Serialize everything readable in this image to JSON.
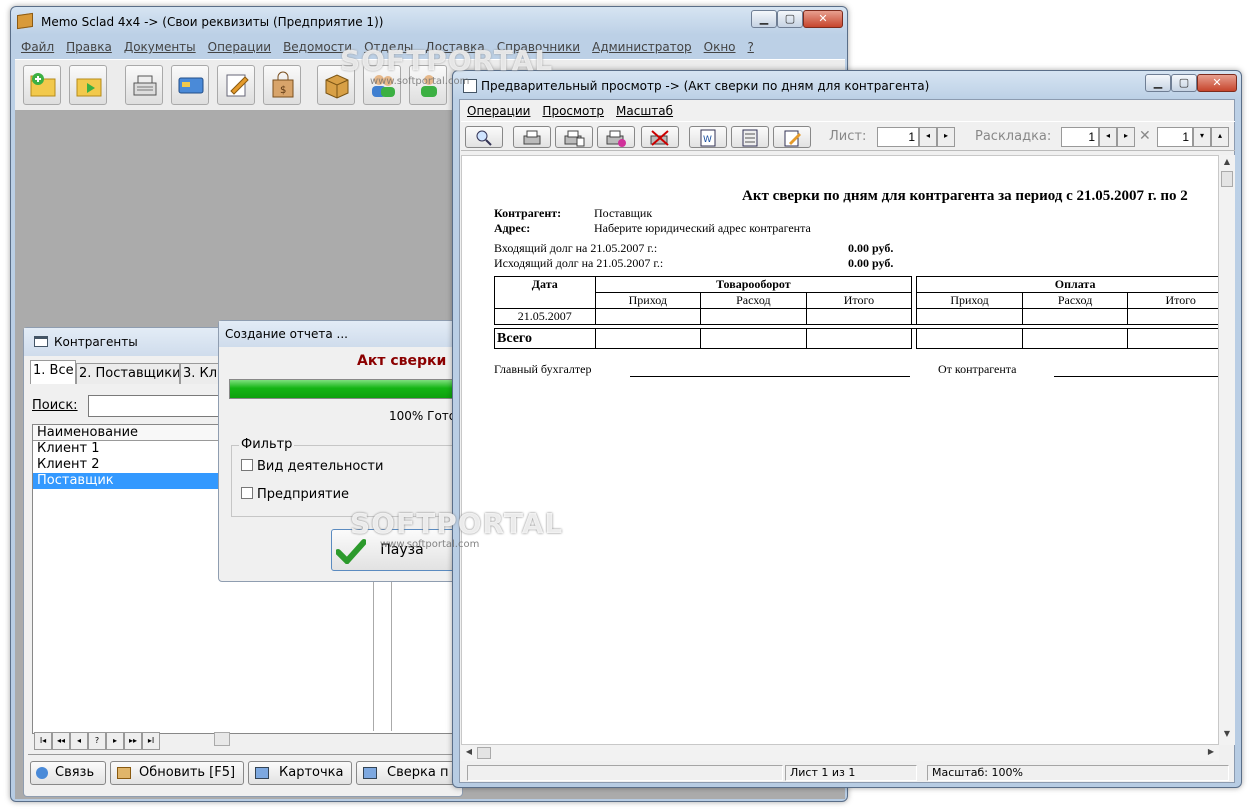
{
  "main_window": {
    "title": "Memo Sclad 4x4 -> (Свои реквизиты (Предприятие 1))",
    "menu": [
      "Файл",
      "Правка",
      "Документы",
      "Операции",
      "Ведомости",
      "Отделы",
      "Доставка",
      "Справочники",
      "Администратор",
      "Окно",
      "?"
    ]
  },
  "contractors": {
    "title": "Контрагенты",
    "tabs": [
      "1. Все",
      "2. Поставщики",
      "3. Кл"
    ],
    "search_label": "Поиск:",
    "search_value": "",
    "column_header": "Наименование",
    "rows": [
      "Клиент 1",
      "Клиент 2",
      "Поставщик"
    ],
    "selected_row": 2,
    "nav_buttons": [
      "I◂",
      "◂◂",
      "◂",
      "?",
      "▸",
      "▸▸",
      "▸I"
    ],
    "buttons": {
      "link": "Связь",
      "refresh": "Обновить [F5]",
      "card": "Карточка",
      "reconcile": "Сверка п"
    }
  },
  "report_dialog": {
    "title": "Создание отчета ...",
    "heading": "Акт сверки п",
    "progress": 1.0,
    "progress_text": "100% Гото",
    "filter_label": "Фильтр",
    "filters": [
      "Вид деятельности",
      "Предприятие"
    ],
    "pause_label": "Пауза"
  },
  "preview": {
    "title": "Предварительный просмотр -> (Акт сверки по дням для контрагента)",
    "menu": [
      "Операции",
      "Просмотр",
      "Масштаб"
    ],
    "sheet_label": "Лист:",
    "sheet_value": "1",
    "layout_label": "Раскладка:",
    "layout_value1": "1",
    "layout_value2": "1",
    "status": {
      "left": "",
      "pages": "Лист 1 из 1",
      "zoom": "Масштаб: 100%"
    },
    "doc": {
      "title": "Акт сверки по дням для контрагента за период с 21.05.2007 г. по 2",
      "contractor_label": "Контрагент:",
      "contractor_value": "Поставщик",
      "address_label": "Адрес:",
      "address_value": "Наберите юридический адрес контрагента",
      "in_debt_label": "Входящий долг на 21.05.2007 г.:",
      "in_debt_value": "0.00 руб.",
      "out_debt_label": "Исходящий долг на 21.05.2007 г.:",
      "out_debt_value": "0.00 руб.",
      "col_date": "Дата",
      "group1": "Товарооборот",
      "group2": "Оплата",
      "sub_in": "Приход",
      "sub_out": "Расход",
      "sub_total": "Итого",
      "row_date": "21.05.2007",
      "total_label": "Всего",
      "accountant": "Главный бухгалтер",
      "from_contractor": "От контрагента"
    }
  },
  "watermark": {
    "brand": "SOFTPORTAL",
    "url": "www.softportal.com"
  }
}
